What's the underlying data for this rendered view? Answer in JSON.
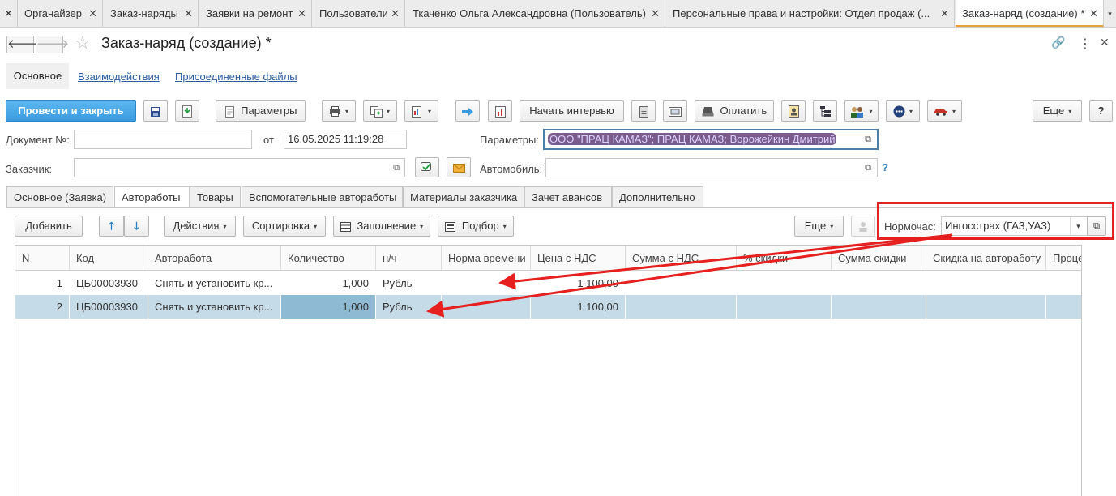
{
  "tabs": [
    {
      "label": "Органайзер"
    },
    {
      "label": "Заказ-наряды"
    },
    {
      "label": "Заявки на ремонт"
    },
    {
      "label": "Пользователи"
    },
    {
      "label": "Ткаченко Ольга Александровна (Пользователь)"
    },
    {
      "label": "Персональные права и настройки: Отдел продаж (..."
    },
    {
      "label": "Заказ-наряд (создание) *"
    }
  ],
  "glyphs": {
    "close": "✕",
    "back": "🡐",
    "forward": "🡒",
    "star": "☆",
    "caret": "▾",
    "dropdown": "▾",
    "pick": "⧉",
    "question": "?",
    "more": "⋮",
    "link": "🔗",
    "up": "🡑",
    "down": "🡓"
  },
  "page": {
    "title": "Заказ-наряд (создание) *"
  },
  "section_tabs": {
    "main": "Основное",
    "interactions": "Взаимодействия",
    "files": "Присоединенные файлы"
  },
  "toolbar": {
    "post_close": "Провести и закрыть",
    "params": "Параметры",
    "start_interview": "Начать интервью",
    "pay": "Оплатить",
    "more": "Еще",
    "help": "?"
  },
  "form": {
    "doc_no_label": "Документ №:",
    "doc_no_value": "",
    "from_label": "от",
    "date_value": "16.05.2025 11:19:28",
    "params_label": "Параметры:",
    "params_value": "ООО \"ПРАЦ КАМАЗ\"; ПРАЦ КАМАЗ; Ворожейкин Дмитрий",
    "customer_label": "Заказчик:",
    "customer_value": "",
    "car_label": "Автомобиль:",
    "car_value": "",
    "car_help": "?"
  },
  "inner_tabs": [
    {
      "label": "Основное (Заявка)"
    },
    {
      "label": "Автоработы"
    },
    {
      "label": "Товары"
    },
    {
      "label": "Вспомогательные автоработы"
    },
    {
      "label": "Материалы заказчика"
    },
    {
      "label": "Зачет авансов"
    },
    {
      "label": "Дополнительно"
    }
  ],
  "table_toolbar": {
    "add": "Добавить",
    "actions": "Действия",
    "sort": "Сортировка",
    "fill": "Заполнение",
    "select": "Подбор",
    "more": "Еще",
    "norm_label": "Нормочас:",
    "norm_value": "Ингосстрах (ГАЗ,УАЗ)"
  },
  "table": {
    "headers": [
      "N",
      "Код",
      "Авторабота",
      "Количество",
      "н/ч",
      "Норма времени",
      "Цена с НДС",
      "Сумма с НДС",
      "% скидки",
      "Сумма скидки",
      "Скидка на автоработу",
      "Процент ск"
    ],
    "rows": [
      [
        "1",
        "ЦБ00003930",
        "Снять и установить кр...",
        "1,000",
        "Рубль",
        "",
        "1 100,00",
        "",
        "",
        "",
        "",
        ""
      ],
      [
        "2",
        "ЦБ00003930",
        "Снять и установить кр...",
        "1,000",
        "Рубль",
        "",
        "1 100,00",
        "",
        "",
        "",
        "",
        ""
      ]
    ],
    "selected_row": 2
  },
  "colors": {
    "accent": "#e8a13b",
    "primary": "#3a9be0",
    "selection": "#c6dbe8",
    "annotation": "#e5201f",
    "link": "#2a5b9c"
  }
}
